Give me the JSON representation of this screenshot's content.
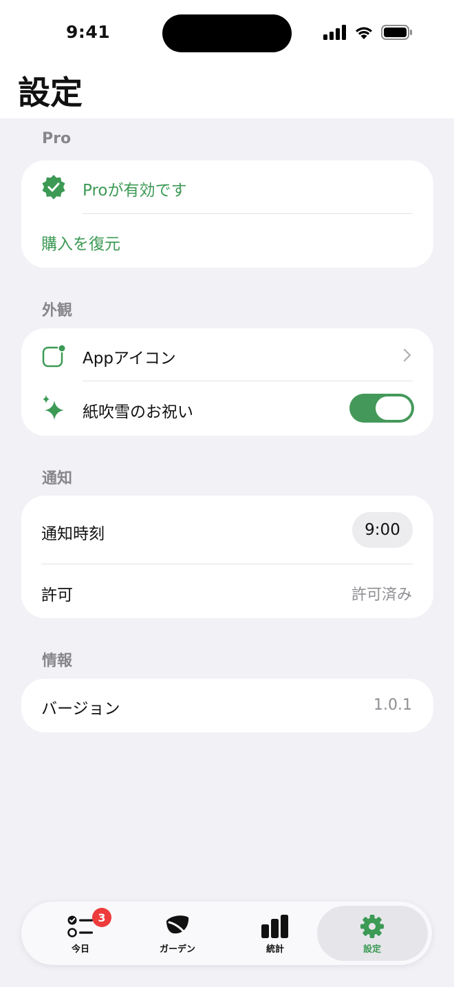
{
  "status_bar": {
    "time": "9:41"
  },
  "page": {
    "title": "設定"
  },
  "sections": {
    "pro": {
      "header": "Pro",
      "active_label": "Proが有効です",
      "restore_label": "購入を復元"
    },
    "appearance": {
      "header": "外観",
      "app_icon_label": "Appアイコン",
      "confetti_label": "紙吹雪のお祝い",
      "confetti_on": true
    },
    "notifications": {
      "header": "通知",
      "time_label": "通知時刻",
      "time_value": "9:00",
      "permission_label": "許可",
      "permission_value": "許可済み"
    },
    "info": {
      "header": "情報",
      "version_label": "バージョン",
      "version_value": "1.0.1"
    }
  },
  "tab_bar": {
    "tabs": [
      {
        "label": "今日",
        "icon": "checklist-icon"
      },
      {
        "label": "ガーデン",
        "icon": "leaf-icon"
      },
      {
        "label": "統計",
        "icon": "bar-chart-icon"
      },
      {
        "label": "設定",
        "icon": "gear-icon"
      }
    ],
    "today_badge": "3",
    "selected": "設定"
  },
  "colors": {
    "accent": "#3c9a55",
    "background": "#f1f1f6",
    "badge": "#ee3b3b"
  }
}
